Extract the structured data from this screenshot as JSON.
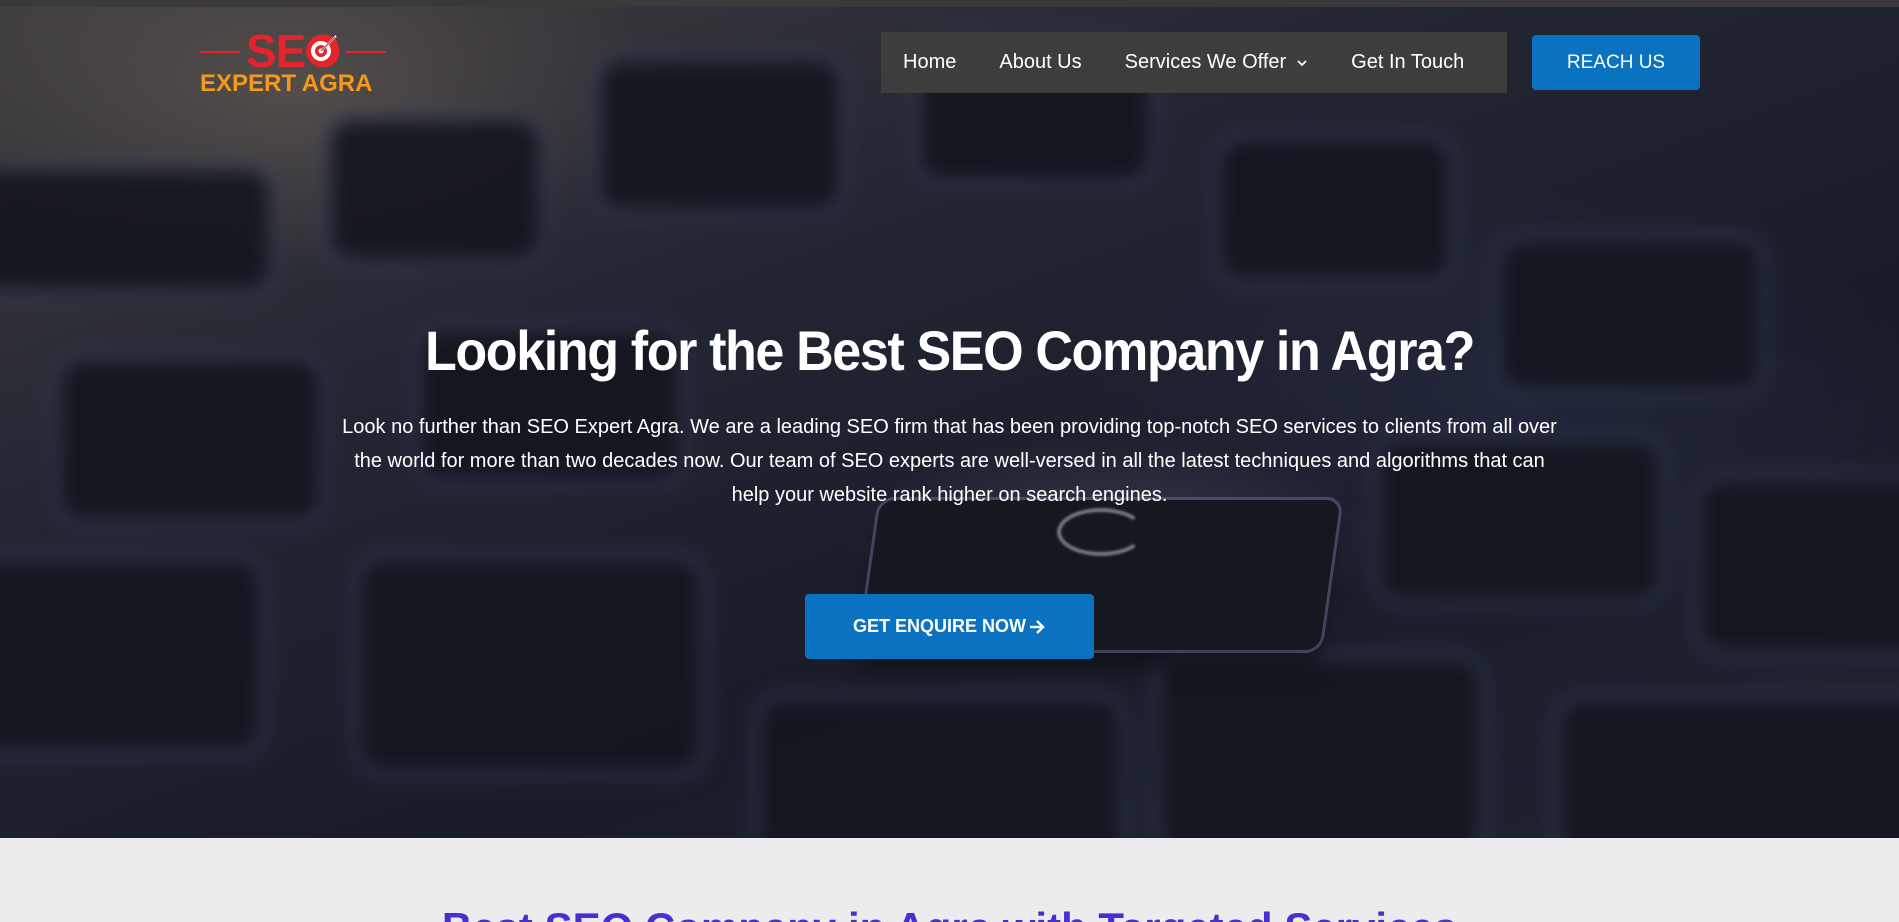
{
  "brand": {
    "logo_main": "SEO",
    "logo_sub": "EXPERT AGRA",
    "colors": {
      "red": "#e3242b",
      "orange": "#f39a1d"
    }
  },
  "nav": {
    "items": [
      {
        "label": "Home"
      },
      {
        "label": "About Us"
      },
      {
        "label": "Services We Offer",
        "has_dropdown": true
      },
      {
        "label": "Get In Touch"
      }
    ],
    "reach_label": "REACH US"
  },
  "hero": {
    "title": "Looking for the Best SEO Company in Agra?",
    "text": "Look no further than SEO Expert Agra. We are a leading SEO firm that has been providing top-notch SEO services to clients from all over the world for more than two decades now. Our team of SEO experts are well-versed in all the latest techniques and algorithms that can help your website rank higher on search engines.",
    "cta_label": "GET ENQUIRE NOW",
    "cta_icon": "arrow-right-icon"
  },
  "section_two": {
    "title": "Best SEO Company in Agra with Targeted Services"
  },
  "colors": {
    "accent": "#0a72c1",
    "nav_bg": "#3d3d3d",
    "section_title": "#4a2fd0"
  }
}
